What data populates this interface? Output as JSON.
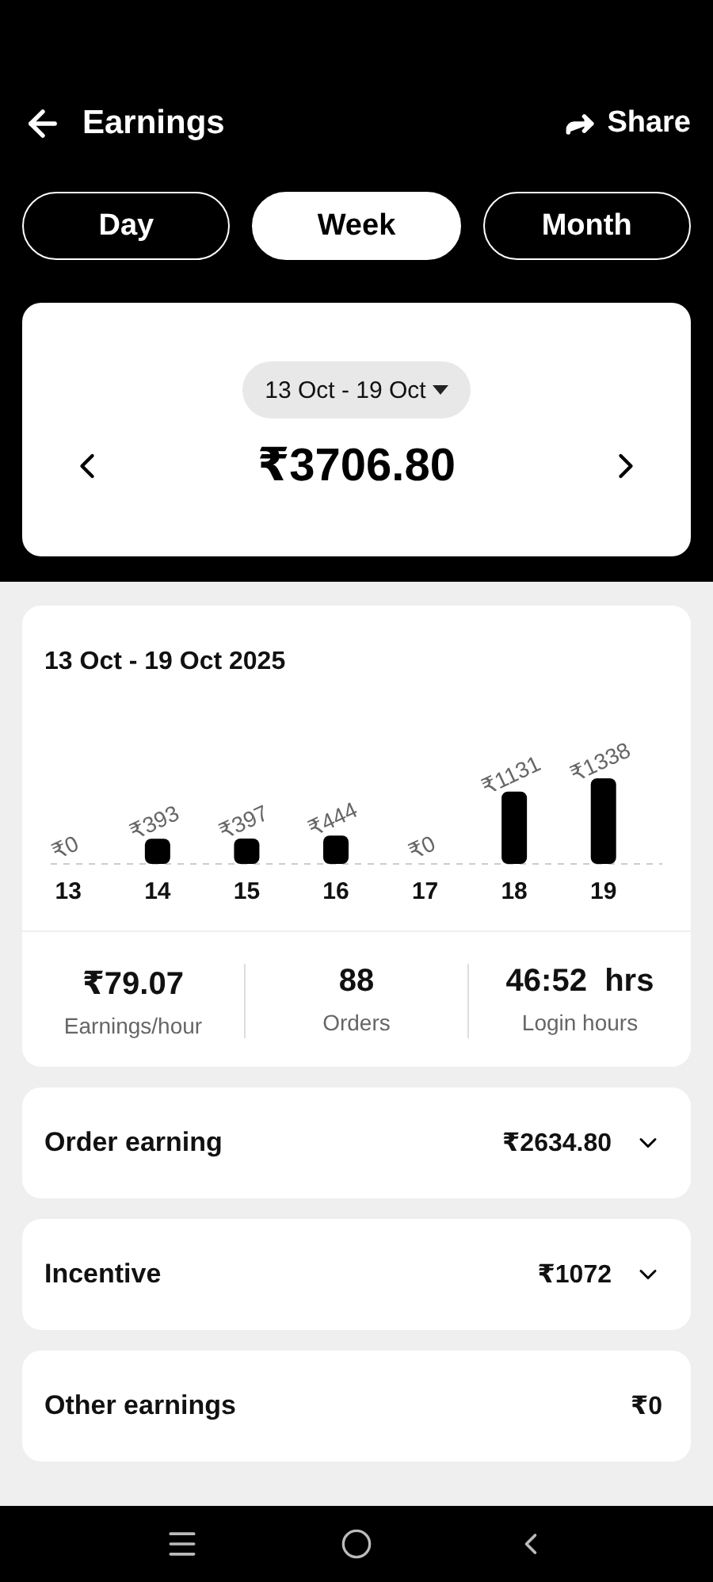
{
  "header": {
    "title": "Earnings",
    "share": "Share"
  },
  "tabs": [
    {
      "label": "Day",
      "selected": false
    },
    {
      "label": "Week",
      "selected": true
    },
    {
      "label": "Month",
      "selected": false
    }
  ],
  "summary": {
    "range": "13 Oct - 19 Oct",
    "total": "₹3706.80"
  },
  "chart_card": {
    "title": "13 Oct - 19 Oct 2025",
    "chart_data": {
      "type": "bar",
      "categories": [
        "13",
        "14",
        "15",
        "16",
        "17",
        "18",
        "19"
      ],
      "series": [
        {
          "color": "#000000",
          "values": [
            0,
            393,
            397,
            444,
            0,
            1131,
            1338
          ],
          "value_labels": [
            "₹0",
            "₹393",
            "₹397",
            "₹444",
            "₹0",
            "₹1131",
            "₹1338"
          ]
        }
      ]
    }
  },
  "stats": [
    {
      "value": "₹79.07",
      "label": "Earnings/hour"
    },
    {
      "value": "88",
      "label": "Orders"
    },
    {
      "value": "46:52  hrs",
      "label": "Login hours"
    }
  ],
  "rows": [
    {
      "label": "Order earning",
      "amount": "₹2634.80",
      "expandable": true
    },
    {
      "label": "Incentive",
      "amount": "₹1072",
      "expandable": true
    },
    {
      "label": "Other earnings",
      "amount": "₹0",
      "expandable": false
    }
  ]
}
